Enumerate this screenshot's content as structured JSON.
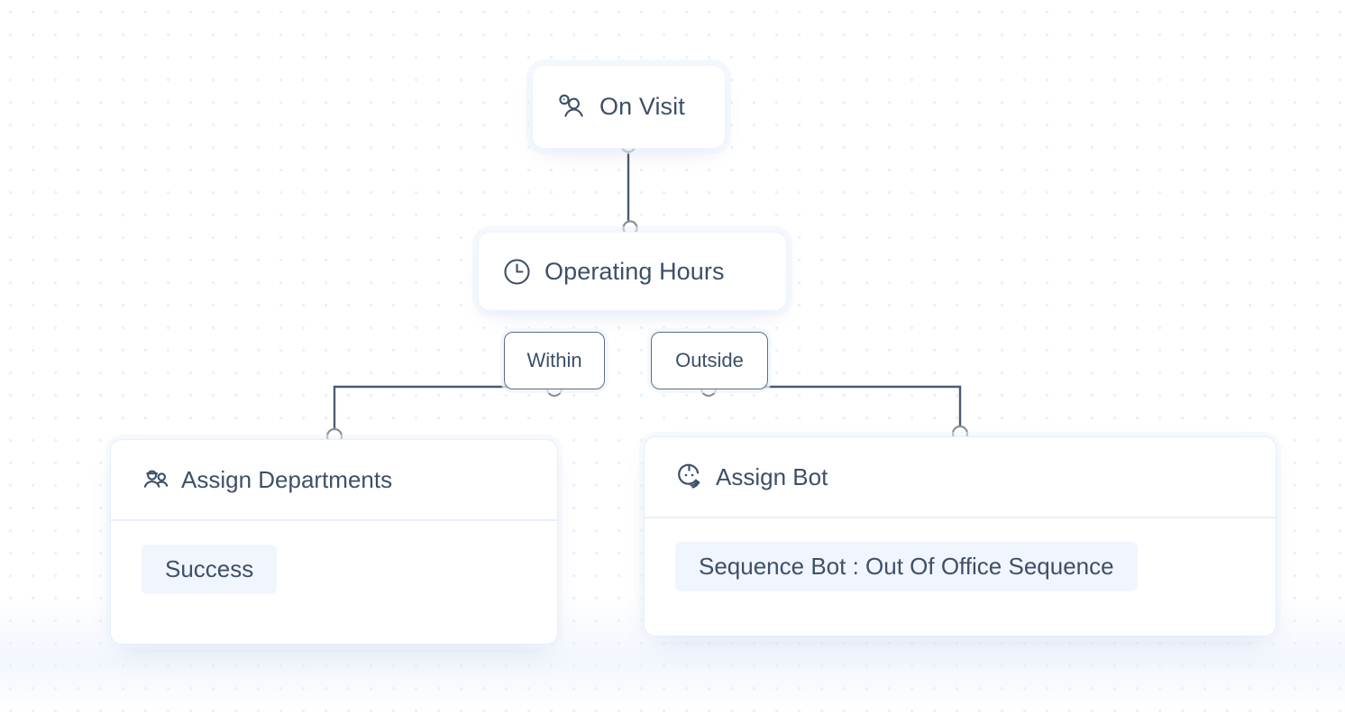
{
  "canvas": {
    "background_color": "#ffffff",
    "dot_color": "#eaf0fb",
    "dot_spacing_px": 25
  },
  "theme": {
    "node_text_color": "#3d5068",
    "node_border_color": "#e6eefb",
    "edge_color": "#4a5b73",
    "port_stroke_color": "#8c8f94",
    "chip_background": "#f1f5fd",
    "branch_border_color": "#5b6d87",
    "divider_color": "#e9effc"
  },
  "flow": {
    "nodes": [
      {
        "id": "on-visit",
        "title": "On Visit",
        "icon": "visitor-person-icon",
        "type": "trigger"
      },
      {
        "id": "operating-hours",
        "title": "Operating Hours",
        "icon": "clock-icon",
        "type": "condition"
      },
      {
        "id": "assign-departments",
        "title": "Assign Departments",
        "icon": "users-group-icon",
        "type": "action",
        "items": [
          "Success"
        ]
      },
      {
        "id": "assign-bot",
        "title": "Assign Bot",
        "icon": "bot-forward-icon",
        "type": "action",
        "items": [
          "Sequence Bot : Out Of Office Sequence"
        ]
      }
    ],
    "branch_labels": [
      {
        "id": "within",
        "label": "Within",
        "from": "operating-hours",
        "to": "assign-departments"
      },
      {
        "id": "outside",
        "label": "Outside",
        "from": "operating-hours",
        "to": "assign-bot"
      }
    ],
    "edges": [
      {
        "from": "on-visit",
        "to": "operating-hours"
      },
      {
        "from": "within",
        "to": "assign-departments"
      },
      {
        "from": "outside",
        "to": "assign-bot"
      }
    ]
  }
}
